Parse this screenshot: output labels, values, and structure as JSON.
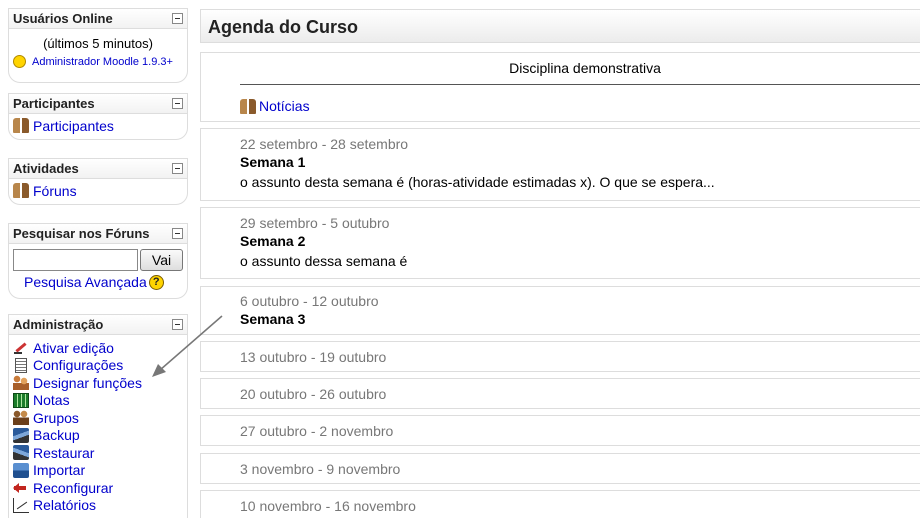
{
  "blocks": {
    "online": {
      "title": "Usuários Online",
      "period": "(últimos 5 minutos)",
      "user": "Administrador Moodle 1.9.3+"
    },
    "participants": {
      "title": "Participantes",
      "link": "Participantes"
    },
    "activities": {
      "title": "Atividades",
      "link": "Fóruns"
    },
    "search": {
      "title": "Pesquisar nos Fóruns",
      "input_value": "",
      "button": "Vai",
      "advanced": "Pesquisa Avançada"
    },
    "admin": {
      "title": "Administração",
      "items": [
        {
          "label": "Ativar edição",
          "icon": "pencil-icon"
        },
        {
          "label": "Configurações",
          "icon": "settings-doc-icon"
        },
        {
          "label": "Designar funções",
          "icon": "roles-icon"
        },
        {
          "label": "Notas",
          "icon": "grades-icon"
        },
        {
          "label": "Grupos",
          "icon": "groups-icon"
        },
        {
          "label": "Backup",
          "icon": "backup-icon"
        },
        {
          "label": "Restaurar",
          "icon": "restore-icon"
        },
        {
          "label": "Importar",
          "icon": "import-icon"
        },
        {
          "label": "Reconfigurar",
          "icon": "reset-icon"
        },
        {
          "label": "Relatórios",
          "icon": "reports-icon"
        }
      ]
    }
  },
  "main": {
    "title": "Agenda do Curso",
    "course_name": "Disciplina demonstrativa",
    "news_link": "Notícias",
    "weeks": [
      {
        "dates": "22 setembro - 28 setembro",
        "title": "Semana 1",
        "summary": "o assunto desta semana é (horas-atividade estimadas x). O que se espera..."
      },
      {
        "dates": "29 setembro - 5 outubro",
        "title": "Semana 2",
        "summary": "o assunto dessa semana é"
      },
      {
        "dates": "6 outubro - 12 outubro",
        "title": "Semana 3",
        "summary": ""
      },
      {
        "dates": "13 outubro - 19 outubro",
        "title": "",
        "summary": ""
      },
      {
        "dates": "20 outubro - 26 outubro",
        "title": "",
        "summary": ""
      },
      {
        "dates": "27 outubro - 2 novembro",
        "title": "",
        "summary": ""
      },
      {
        "dates": "3 novembro - 9 novembro",
        "title": "",
        "summary": ""
      },
      {
        "dates": "10 novembro - 16 novembro",
        "title": "",
        "summary": ""
      }
    ]
  },
  "colors": {
    "link": "#0000cc",
    "border": "#dddddd",
    "dates": "#777777"
  }
}
